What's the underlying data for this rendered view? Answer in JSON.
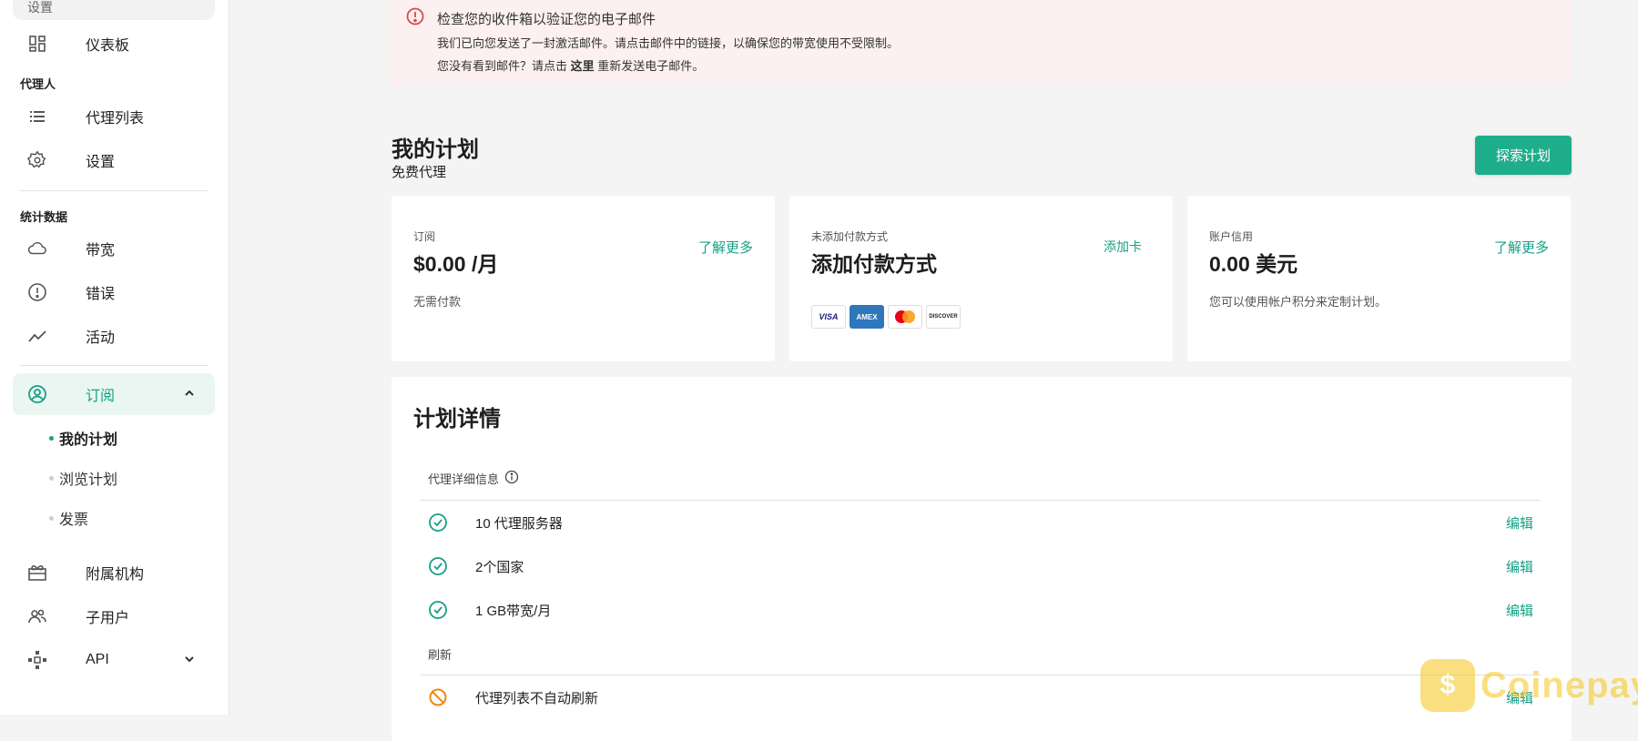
{
  "sidebar": {
    "top_stub": "设置",
    "dashboard": "仪表板",
    "section_proxy": "代理人",
    "proxy_list": "代理列表",
    "settings": "设置",
    "section_stats": "统计数据",
    "bandwidth": "带宽",
    "errors": "错误",
    "activity": "活动",
    "subscription": "订阅",
    "sub_items": [
      "我的计划",
      "浏览计划",
      "发票"
    ],
    "affiliate": "附属机构",
    "sub_users": "子用户",
    "api": "API"
  },
  "alert": {
    "title": "检查您的收件箱以验证您的电子邮件",
    "line1": "我们已向您发送了一封激活邮件。请点击邮件中的链接，以确保您的带宽使用不受限制。",
    "line2_pre": "您没有看到邮件？请点击",
    "line2_link": "这里",
    "line2_post": "重新发送电子邮件。"
  },
  "plan": {
    "title": "我的计划",
    "subtitle": "免费代理",
    "explore_button": "探索计划"
  },
  "cards": [
    {
      "small": "订阅",
      "big": "$0.00 /月",
      "note": "无需付款",
      "link": "了解更多"
    },
    {
      "small": "未添加付款方式",
      "big": "添加付款方式",
      "link": "添加卡",
      "payment_icons": [
        "VISA",
        "AMEX",
        "mastercard",
        "DISCOVER"
      ]
    },
    {
      "small": "账户信用",
      "big": "0.00 美元",
      "note": "您可以使用帐户积分来定制计划。",
      "link": "了解更多"
    }
  ],
  "details": {
    "title": "计划详情",
    "section1": "代理详细信息",
    "rows": [
      {
        "text": "10 代理服务器",
        "edit": "编辑"
      },
      {
        "text": "2个国家",
        "edit": "编辑"
      },
      {
        "text": "1 GB带宽/月",
        "edit": "编辑"
      }
    ],
    "section2": "刷新",
    "refresh_row": {
      "text": "代理列表不自动刷新",
      "edit": "编辑"
    }
  },
  "watermark": {
    "name": "Coinepay"
  },
  "colors": {
    "accent": "#1fae8b",
    "alert_bg": "#fdf0f0",
    "alert_icon": "#d94848",
    "warn_orange": "#f0890d"
  }
}
